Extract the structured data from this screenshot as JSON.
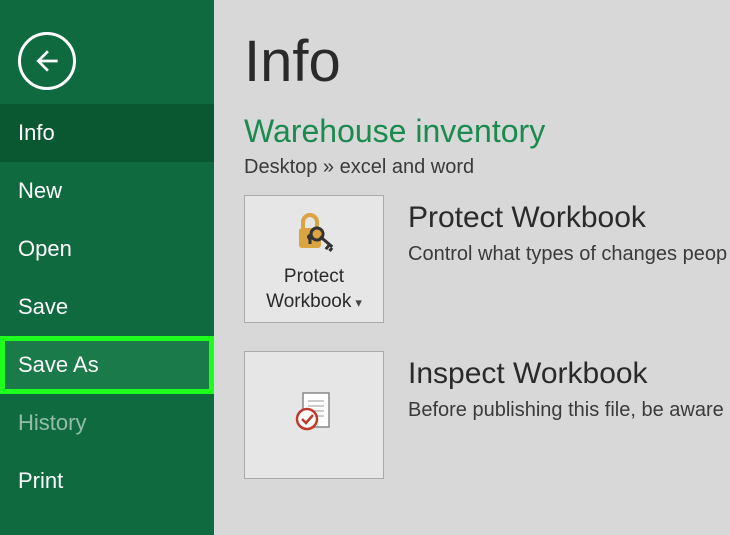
{
  "sidebar": {
    "items": [
      {
        "label": "Info",
        "state": "active"
      },
      {
        "label": "New",
        "state": ""
      },
      {
        "label": "Open",
        "state": ""
      },
      {
        "label": "Save",
        "state": ""
      },
      {
        "label": "Save As",
        "state": "highlighted"
      },
      {
        "label": "History",
        "state": "dimmed"
      },
      {
        "label": "Print",
        "state": ""
      }
    ]
  },
  "main": {
    "page_title": "Info",
    "doc_title": "Warehouse inventory",
    "doc_path": "Desktop » excel and word",
    "sections": [
      {
        "button_label": "Protect Workbook",
        "heading": "Protect Workbook",
        "desc": "Control what types of changes peop"
      },
      {
        "button_label": "",
        "heading": "Inspect Workbook",
        "desc": "Before publishing this file, be aware"
      }
    ]
  }
}
